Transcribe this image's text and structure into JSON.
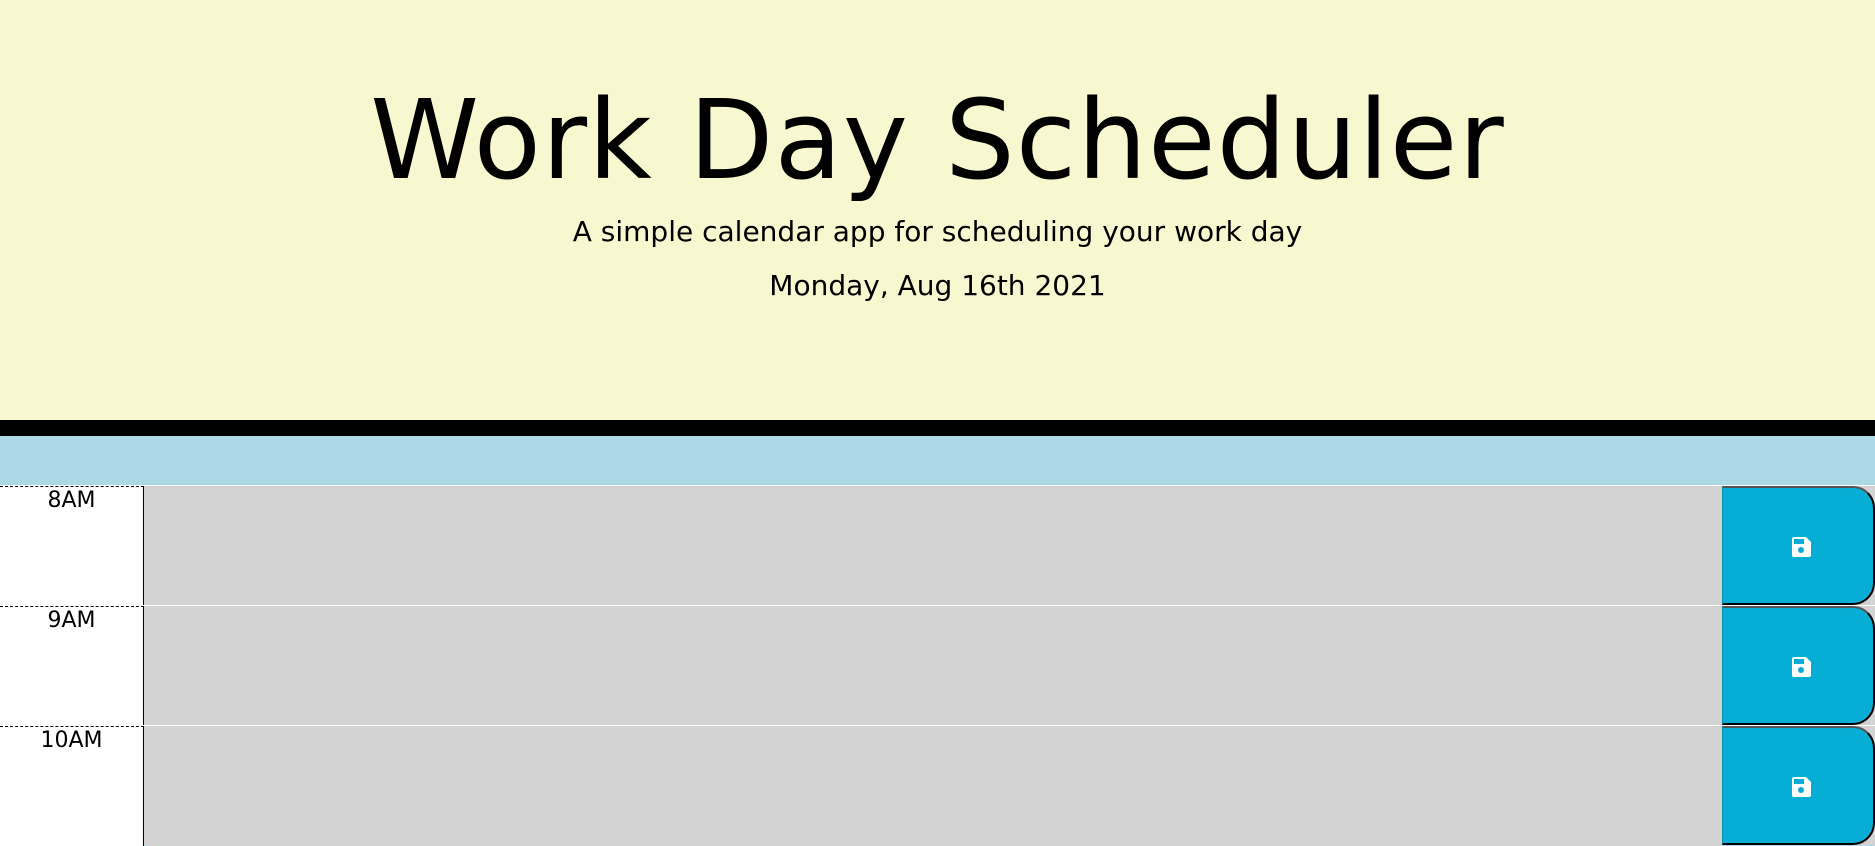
{
  "header": {
    "title": "Work Day Scheduler",
    "subtitle": "A simple calendar app for scheduling your work day",
    "current_day": "Monday, Aug 16th 2021"
  },
  "colors": {
    "header_bg": "#f8f8d0",
    "page_bg": "#add8e6",
    "slot_bg": "#d3d3d3",
    "save_button": "#06aed5"
  },
  "time_blocks": [
    {
      "hour": "8AM",
      "text": "",
      "save_icon": "save-icon"
    },
    {
      "hour": "9AM",
      "text": "",
      "save_icon": "save-icon"
    },
    {
      "hour": "10AM",
      "text": "",
      "save_icon": "save-icon"
    }
  ]
}
